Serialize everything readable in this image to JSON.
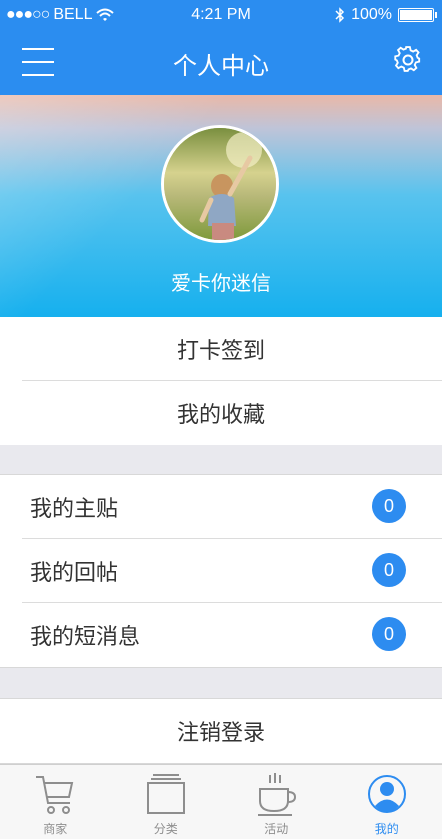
{
  "status_bar": {
    "carrier": "BELL",
    "signal": "●●●○○",
    "time": "4:21 PM",
    "battery": "100%"
  },
  "nav": {
    "title": "个人中心"
  },
  "profile": {
    "username": "爱卡你迷信"
  },
  "group1": [
    {
      "label": "打卡签到"
    },
    {
      "label": "我的收藏"
    }
  ],
  "group2": [
    {
      "label": "我的主贴",
      "count": "0"
    },
    {
      "label": "我的回帖",
      "count": "0"
    },
    {
      "label": "我的短消息",
      "count": "0"
    }
  ],
  "logout": {
    "label": "注销登录"
  },
  "tabs": [
    {
      "label": "商家",
      "icon": "cart-icon"
    },
    {
      "label": "分类",
      "icon": "category-icon"
    },
    {
      "label": "活动",
      "icon": "coffee-cup-icon"
    },
    {
      "label": "我的",
      "icon": "user-icon",
      "active": true
    }
  ],
  "colors": {
    "accent": "#2b8df0",
    "badge": "#2d8cf0"
  }
}
